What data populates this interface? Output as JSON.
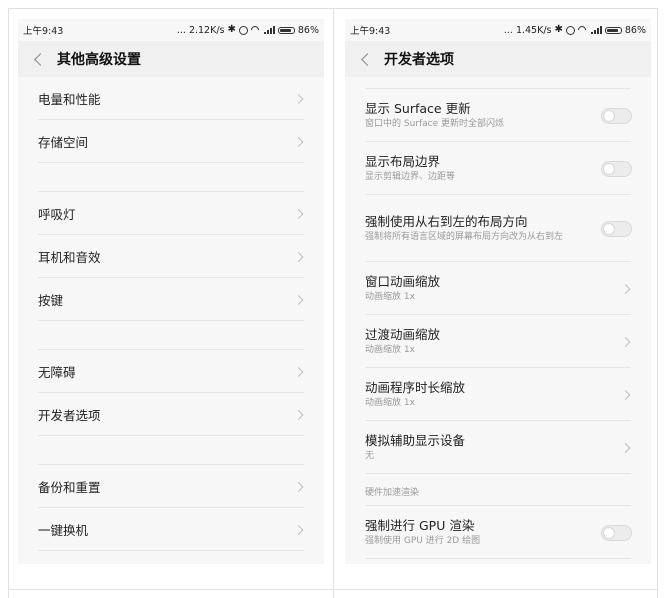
{
  "left": {
    "status": {
      "time": "上午9:43",
      "net_speed": "... 2.12K/s",
      "battery": "86%"
    },
    "title": "其他高级设置",
    "groups": [
      [
        "电量和性能",
        "存储空间"
      ],
      [
        "呼吸灯",
        "耳机和音效",
        "按键"
      ],
      [
        "无障碍",
        "开发者选项"
      ],
      [
        "备份和重置",
        "一键换机"
      ]
    ]
  },
  "right": {
    "status": {
      "time": "上午9:43",
      "net_speed": "... 1.45K/s",
      "battery": "86%"
    },
    "title": "开发者选项",
    "items": [
      {
        "title": "显示 Surface 更新",
        "subtitle": "窗口中的 Surface 更新时全部闪烁",
        "control": "toggle",
        "checked": false
      },
      {
        "title": "显示布局边界",
        "subtitle": "显示剪辑边界、边距等",
        "control": "toggle",
        "checked": false
      },
      {
        "title": "强制使用从右到左的布局方向",
        "subtitle": "强制将所有语言区域的屏幕布局方向改为从右到左",
        "control": "toggle",
        "checked": false
      },
      {
        "title": "窗口动画缩放",
        "subtitle": "动画缩放 1x",
        "control": "chevron"
      },
      {
        "title": "过渡动画缩放",
        "subtitle": "动画缩放 1x",
        "control": "chevron"
      },
      {
        "title": "动画程序时长缩放",
        "subtitle": "动画缩放 1x",
        "control": "chevron"
      },
      {
        "title": "模拟辅助显示设备",
        "subtitle": "无",
        "control": "chevron"
      }
    ],
    "section_header": "硬件加速渲染",
    "bottom_item": {
      "title": "强制进行 GPU 渲染",
      "subtitle": "强制使用 GPU 进行 2D 绘图",
      "control": "toggle",
      "checked": false
    }
  }
}
